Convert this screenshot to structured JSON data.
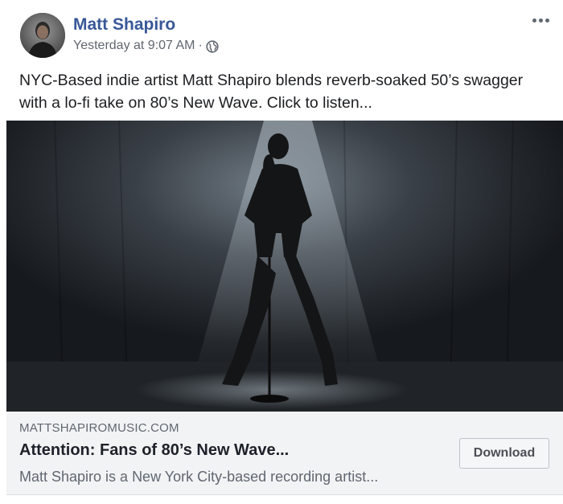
{
  "post": {
    "author": "Matt Shapiro",
    "timestamp": "Yesterday at 9:07 AM",
    "separator": "·",
    "privacy_icon": "globe-icon",
    "more_icon": "more-options-icon",
    "text": "NYC-Based indie artist Matt Shapiro blends reverb-soaked 50’s swagger with a lo-fi take on 80’s New Wave. Click to listen..."
  },
  "link_preview": {
    "domain": "MATTSHAPIROMUSIC.COM",
    "title": "Attention: Fans of 80’s New Wave...",
    "description": "Matt Shapiro is a New York City-based recording artist...",
    "button_label": "Download"
  },
  "colors": {
    "author_link": "#385898",
    "meta_text": "#616770",
    "link_box_bg": "#f2f3f5"
  }
}
